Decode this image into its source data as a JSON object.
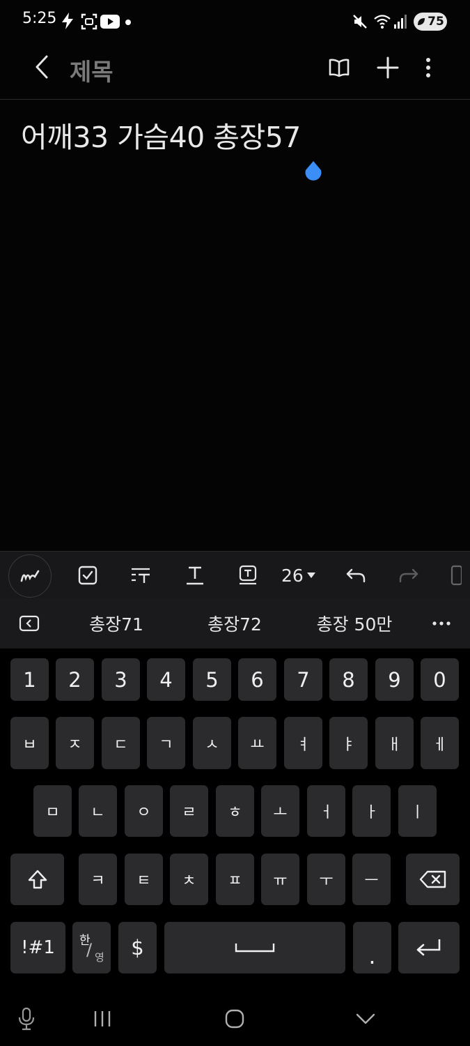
{
  "status_bar": {
    "time": "5:25",
    "battery": "75"
  },
  "app_bar": {
    "title": "제목"
  },
  "note": {
    "text": "어깨33 가슴40 총장57"
  },
  "toolbar": {
    "font_size": "26"
  },
  "suggestions": [
    "총장71",
    "총장72",
    "총장 50만"
  ],
  "keyboard": {
    "row_numbers": [
      "1",
      "2",
      "3",
      "4",
      "5",
      "6",
      "7",
      "8",
      "9",
      "0"
    ],
    "row1": [
      "ㅂ",
      "ㅈ",
      "ㄷ",
      "ㄱ",
      "ㅅ",
      "ㅛ",
      "ㅕ",
      "ㅑ",
      "ㅐ",
      "ㅔ"
    ],
    "row2": [
      "ㅁ",
      "ㄴ",
      "ㅇ",
      "ㄹ",
      "ㅎ",
      "ㅗ",
      "ㅓ",
      "ㅏ",
      "ㅣ"
    ],
    "row3": [
      "ㅋ",
      "ㅌ",
      "ㅊ",
      "ㅍ",
      "ㅠ",
      "ㅜ",
      "ㅡ"
    ],
    "symbols_label": "!#1",
    "lang_top": "한",
    "lang_bottom": "영",
    "dollar": "$",
    "period": "."
  },
  "colors": {
    "accent_handle": "#3a8ef6",
    "key_bg": "#2b2b2d",
    "toolbar_bg": "#18181a"
  }
}
